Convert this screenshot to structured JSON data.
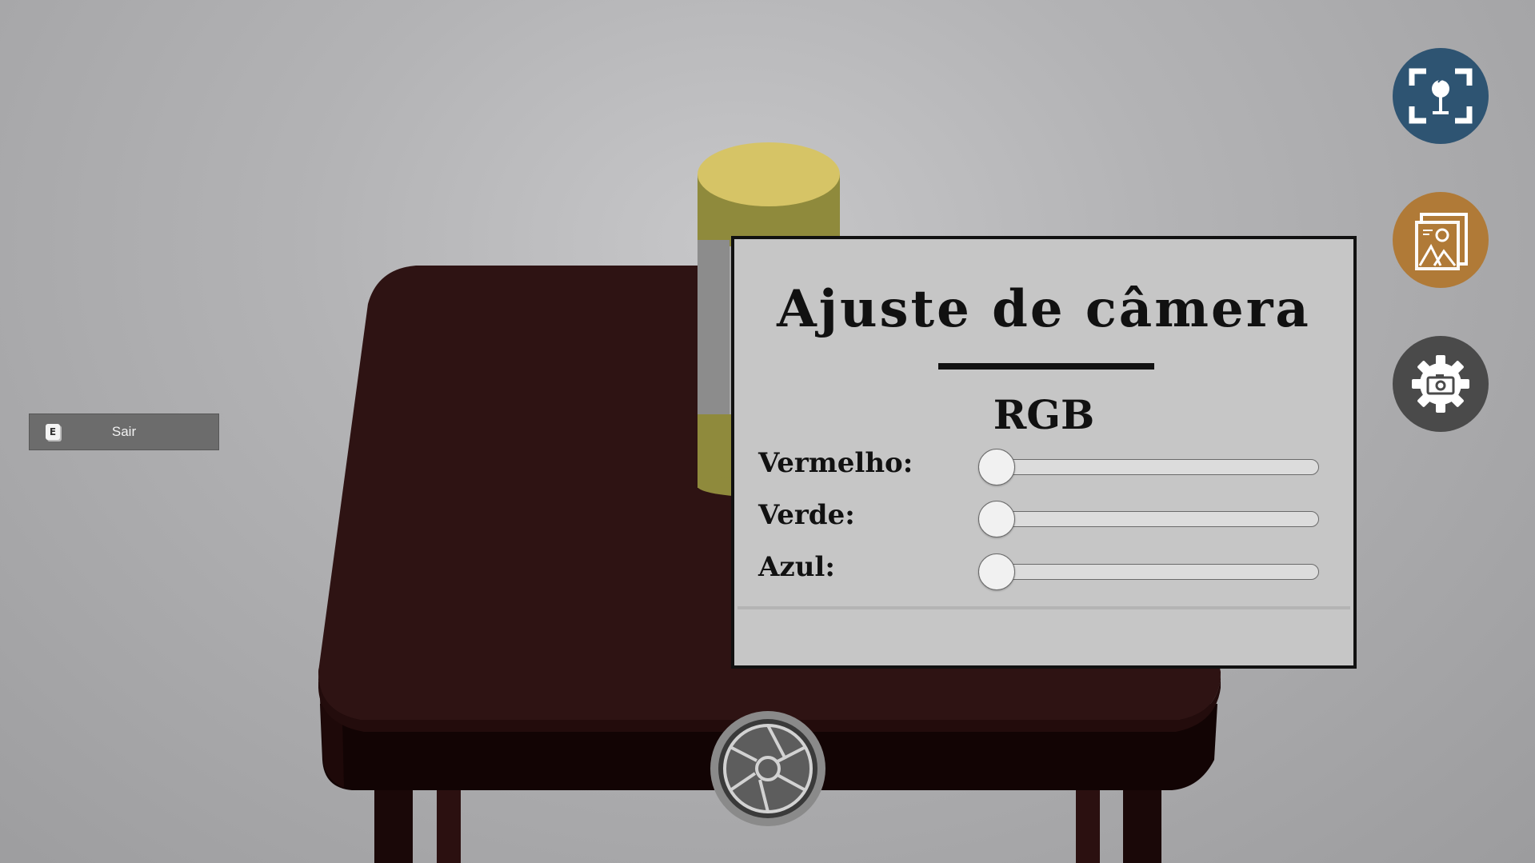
{
  "exit_button": {
    "key": "E",
    "label": "Sair"
  },
  "toolbar": {
    "focus_icon": "focus-frame-icon",
    "gallery_icon": "gallery-icon",
    "settings_icon": "camera-settings-icon",
    "shutter_icon": "shutter-icon"
  },
  "panel": {
    "title": "Ajuste de câmera",
    "subtitle": "RGB",
    "sliders": [
      {
        "label": "Vermelho:",
        "value": 0
      },
      {
        "label": "Verde:",
        "value": 0
      },
      {
        "label": "Azul:",
        "value": 0
      }
    ]
  },
  "colors": {
    "focus_button": "#2e5472",
    "gallery_button": "#b07a37",
    "settings_button": "#4a4a4a",
    "panel_background": "#c6c6c6",
    "exit_button": "#6c6c6c"
  }
}
